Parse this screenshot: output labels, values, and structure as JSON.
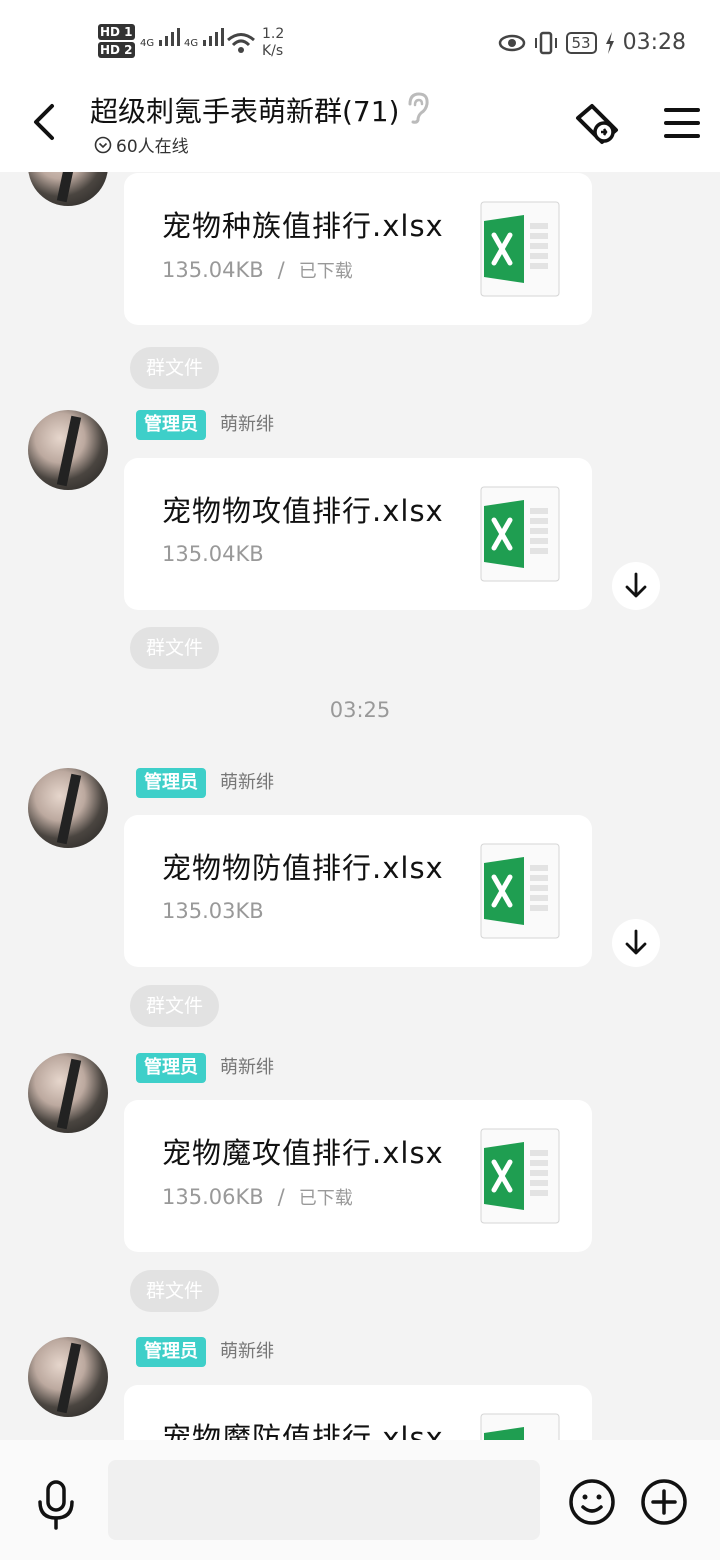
{
  "status_bar": {
    "hd1": "HD 1",
    "hd2": "HD 2",
    "signal1": "4G",
    "signal2": "4G",
    "speed_value": "1.2",
    "speed_unit": "K/s",
    "battery": "53",
    "time": "03:28"
  },
  "header": {
    "title": "超级刺氪手表萌新群(71)",
    "online": "60人在线"
  },
  "messages": [
    {
      "file_name": "宠物种族值排行.xlsx",
      "size": "135.04KB",
      "separator": "/",
      "status": "已下载",
      "tag": "群文件"
    },
    {
      "role": "管理员",
      "sender": "萌新绯",
      "file_name": "宠物物攻值排行.xlsx",
      "size": "135.04KB",
      "tag": "群文件"
    },
    {
      "role": "管理员",
      "sender": "萌新绯",
      "file_name": "宠物物防值排行.xlsx",
      "size": "135.03KB",
      "tag": "群文件"
    },
    {
      "role": "管理员",
      "sender": "萌新绯",
      "file_name": "宠物魔攻值排行.xlsx",
      "size": "135.06KB",
      "separator": "/",
      "status": "已下载",
      "tag": "群文件"
    },
    {
      "role": "管理员",
      "sender": "萌新绯",
      "file_name": "宠物魔防值排行.xlsx"
    }
  ],
  "timestamp": "03:25",
  "colors": {
    "admin_badge": "#3ecfc9",
    "excel_green": "#1f9e51",
    "background": "#f3f3f3"
  }
}
